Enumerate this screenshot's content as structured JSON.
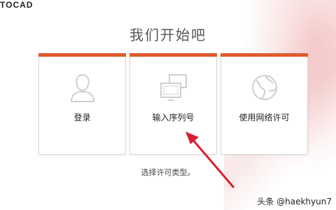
{
  "app": {
    "logo_text": "TOCAD"
  },
  "main": {
    "title": "我们开始吧",
    "options": [
      {
        "label": "登录",
        "icon": "user-icon"
      },
      {
        "label": "输入序列号",
        "icon": "screens-icon"
      },
      {
        "label": "使用网络许可",
        "icon": "globe-icon"
      }
    ],
    "hint": "选择许可类型。"
  },
  "watermark": "头条 @haekhyun7",
  "colors": {
    "accent": "#e05a2b",
    "arrow": "#d82030"
  }
}
